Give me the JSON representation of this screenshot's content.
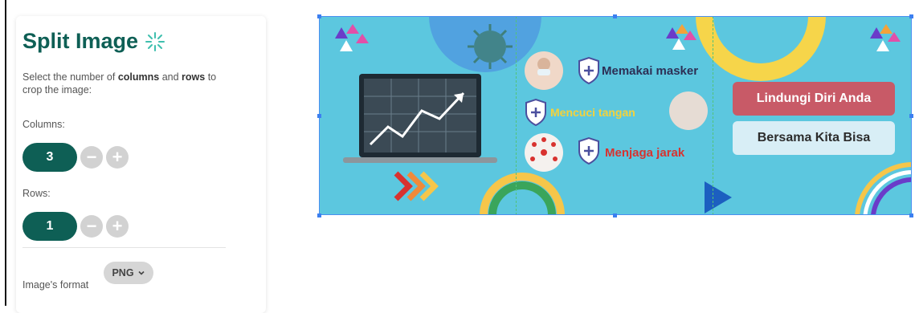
{
  "panel": {
    "title": "Split Image",
    "desc": {
      "p1": "Select the number of ",
      "b1": "columns",
      "p2": " and ",
      "b2": "rows",
      "p3": " to crop the image:"
    },
    "columns_label": "Columns:",
    "columns_value": "3",
    "rows_label": "Rows:",
    "rows_value": "1",
    "minus": "−",
    "plus": "+",
    "format_label": "Image's format",
    "format_value": "PNG"
  },
  "banner": {
    "item1": "Memakai masker",
    "item2": "Mencuci tangan",
    "item3": "Menjaga jarak",
    "pill1": "Lindungi Diri Anda",
    "pill2": "Bersama Kita Bisa"
  },
  "colors": {
    "accent": "#0e5f55",
    "banner_bg": "#5cc7df",
    "pill1_bg": "#c85a67",
    "pill2_bg": "#d8eef6",
    "item2_color": "#f4d23b",
    "item3_color": "#d8322f"
  }
}
